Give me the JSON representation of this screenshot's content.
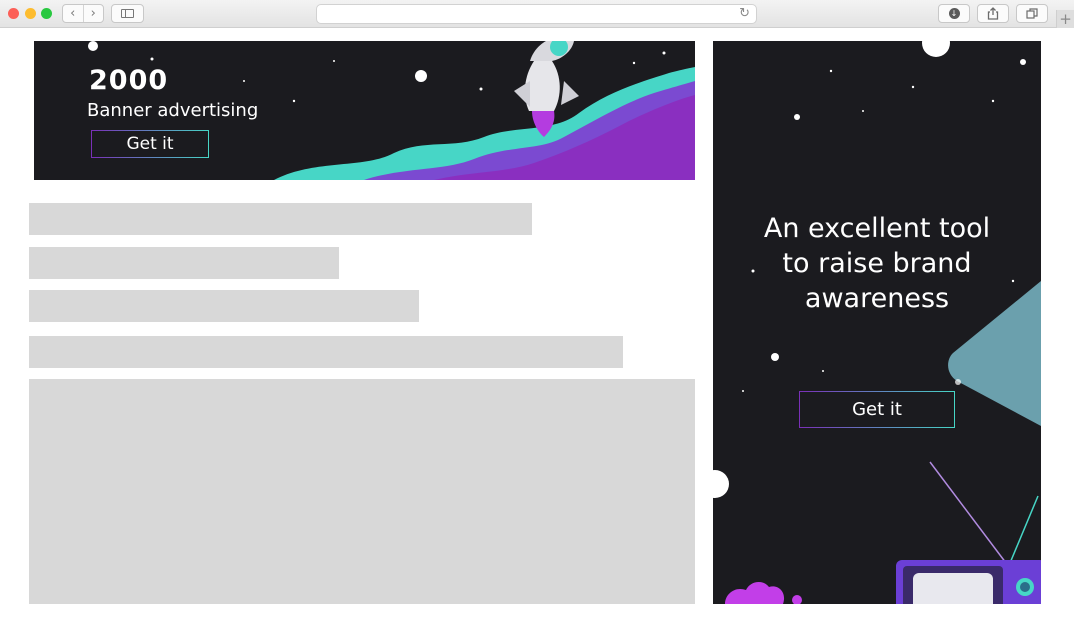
{
  "browser": {
    "address_value": "",
    "reload_icon": "reload-icon",
    "nav_back_icon": "chevron-left-icon",
    "nav_forward_icon": "chevron-right-icon",
    "new_tab_glyph": "+"
  },
  "top_banner": {
    "number": "2000",
    "subtitle": "Banner advertising",
    "cta_label": "Get it"
  },
  "side_banner": {
    "headline_line1": "An excellent tool",
    "headline_line2": "to raise brand",
    "headline_line3": "awareness",
    "cta_label": "Get it"
  },
  "colors": {
    "banner_bg": "#1b1b1f",
    "accent_teal": "#47d6c6",
    "accent_purple": "#8a2fc0",
    "skeleton_gray": "#d8d8d8"
  }
}
